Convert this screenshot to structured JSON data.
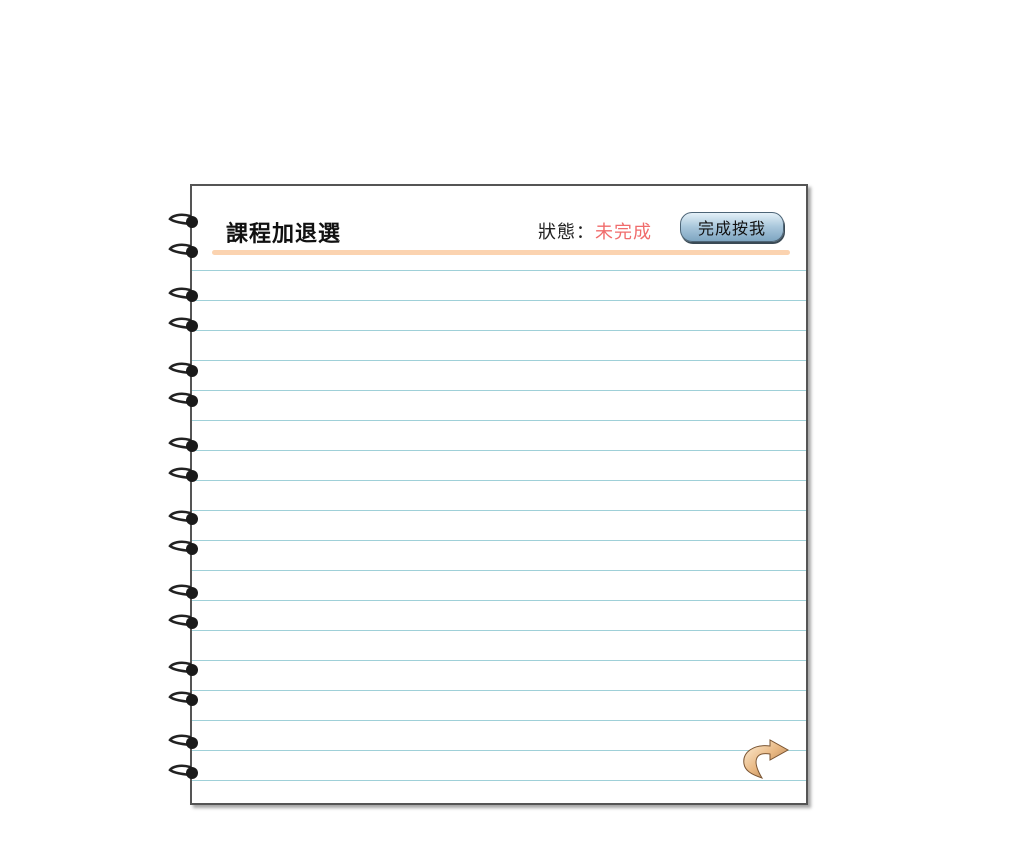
{
  "page": {
    "title": "課程加退選",
    "status_label": "狀態：",
    "status_value": "未完成",
    "done_button_label": "完成按我"
  },
  "icons": {
    "spiral_ring": "spiral-binding-ring-icon",
    "back": "back-arrow-icon"
  },
  "colors": {
    "status_value": "#f06c6c",
    "header_rule": "#fbd3b0",
    "ruled_line": "#9fd0d8",
    "button_blue": "#a8c6db"
  }
}
